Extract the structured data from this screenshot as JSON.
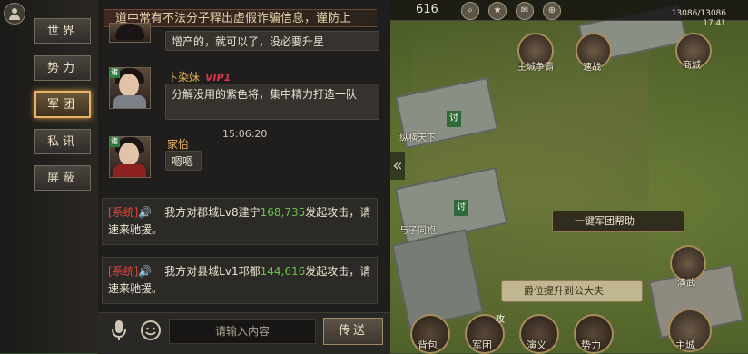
{
  "notice": "道中常有不法分子释出虚假诈骗信息，谨防上",
  "categories": [
    "世界",
    "势力",
    "军团",
    "私讯",
    "屏蔽"
  ],
  "active_category": "军团",
  "messages": {
    "m0": {
      "text": "增产的，就可以了，没必要升星"
    },
    "m1": {
      "name": "卞染妹",
      "vip": "VIP1",
      "text": "分解没用的紫色将，集中精力打造一队"
    },
    "time": "15:06:20",
    "m2": {
      "name": "家怡",
      "text": "嗯嗯"
    }
  },
  "system": [
    {
      "tag": "[系统]",
      "pre": "我方对郡城Lv8建宁",
      "coord": "168,735",
      "post": "发起攻击，请速来驰援。"
    },
    {
      "tag": "[系统]",
      "pre": "我方对县城Lv1邛都",
      "coord": "144,616",
      "post": "发起攻击，请速来驰援。"
    }
  ],
  "input": {
    "placeholder": "请输入内容",
    "send": "传送"
  },
  "topbar": {
    "coord": "616",
    "res": "13086/13086",
    "res2": "17.41"
  },
  "map": {
    "labels": [
      "主城争霸",
      "速战",
      "商城",
      "纵横天下",
      "与子同袍",
      "演武",
      "主城"
    ],
    "help_button": "一键军团帮助",
    "rank_banner": "爵位提升到公大夫",
    "city_tag": "讨"
  },
  "nav": [
    "背包",
    "军团",
    "演义",
    "势力"
  ],
  "nav_badge": "攻"
}
